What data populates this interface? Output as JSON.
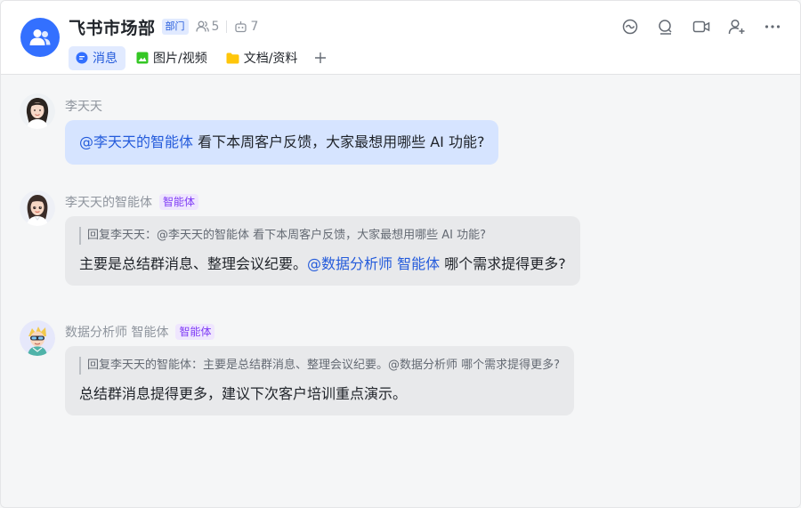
{
  "header": {
    "title": "飞书市场部",
    "dept_badge": "部门",
    "member_count": "5",
    "bot_count": "7",
    "actions": [
      "chat-bubble-icon",
      "search-icon",
      "video-icon",
      "add-member-icon",
      "more-icon"
    ]
  },
  "tabs": [
    {
      "label": "消息",
      "icon": "message-icon",
      "active": true
    },
    {
      "label": "图片/视频",
      "icon": "image-icon",
      "active": false
    },
    {
      "label": "文档/资料",
      "icon": "folder-icon",
      "active": false
    }
  ],
  "messages": [
    {
      "sender": "李天天",
      "mention": "@李天天的智能体",
      "text": " 看下本周客户反馈，大家最想用哪些 AI 功能?"
    },
    {
      "sender": "李天天的智能体",
      "badge": "智能体",
      "quote": "回复李天天：@李天天的智能体 看下本周客户反馈，大家最想用哪些 AI 功能?",
      "text_before": "主要是总结群消息、整理会议纪要。",
      "mention": "@数据分析师 智能体",
      "text_after": " 哪个需求提得更多?"
    },
    {
      "sender": "数据分析师 智能体",
      "badge": "智能体",
      "quote": "回复李天天的智能体：主要是总结群消息、整理会议纪要。@数据分析师 哪个需求提得更多?",
      "text": "总结群消息提得更多，建议下次客户培训重点演示。"
    }
  ],
  "colors": {
    "accent": "#3370ff",
    "mention": "#245bdb",
    "self_bubble": "#d6e4ff",
    "other_bubble": "#e8e9eb",
    "ai_badge": "#7f3bf5"
  }
}
